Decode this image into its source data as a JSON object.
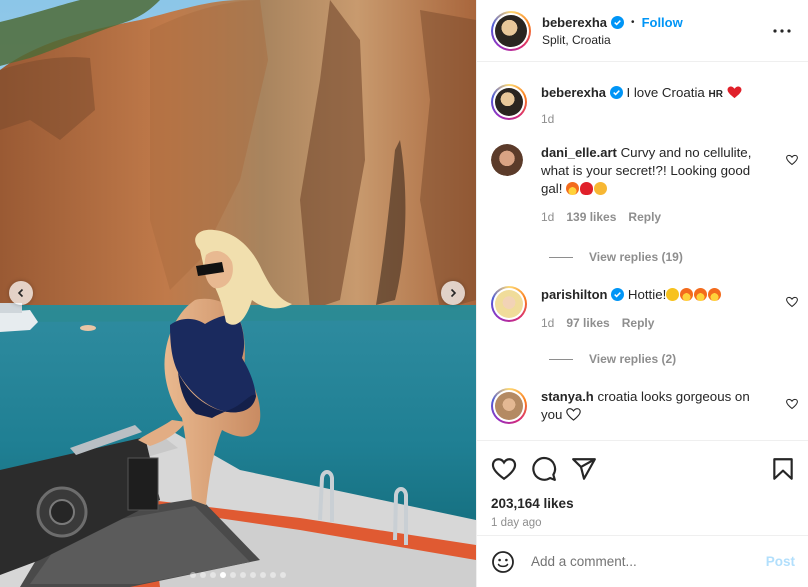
{
  "post": {
    "author": "beberexha",
    "follow_label": "Follow",
    "bullet": "•",
    "location": "Split, Croatia",
    "caption_text": "I love Croatia",
    "caption_flag": "HR",
    "caption_time": "1d",
    "likes_total": "203,164 likes",
    "posted_ago": "1 day ago"
  },
  "comments": [
    {
      "user": "dani_elle.art",
      "text": "Curvy and no cellulite, what is your secret!?! Looking good gal!",
      "time": "1d",
      "likes": "139 likes",
      "reply_label": "Reply",
      "view_replies": "View replies (19)"
    },
    {
      "user": "parishilton",
      "text": "Hottie!",
      "time": "1d",
      "likes": "97 likes",
      "reply_label": "Reply",
      "view_replies": "View replies (2)"
    },
    {
      "user": "stanya.h",
      "text": "croatia looks gorgeous on you"
    }
  ],
  "composer": {
    "placeholder": "Add a comment...",
    "post_label": "Post"
  },
  "carousel": {
    "slides": 10,
    "active_index": 3
  },
  "colors": {
    "accent": "#0095f6",
    "heart": "#ed4956",
    "muted": "#8e8e8e"
  },
  "icons": [
    "verified-badge-icon",
    "more-options-icon",
    "heart-icon",
    "comment-icon",
    "share-icon",
    "bookmark-icon",
    "emoji-icon",
    "chevron-left-icon",
    "chevron-right-icon"
  ]
}
